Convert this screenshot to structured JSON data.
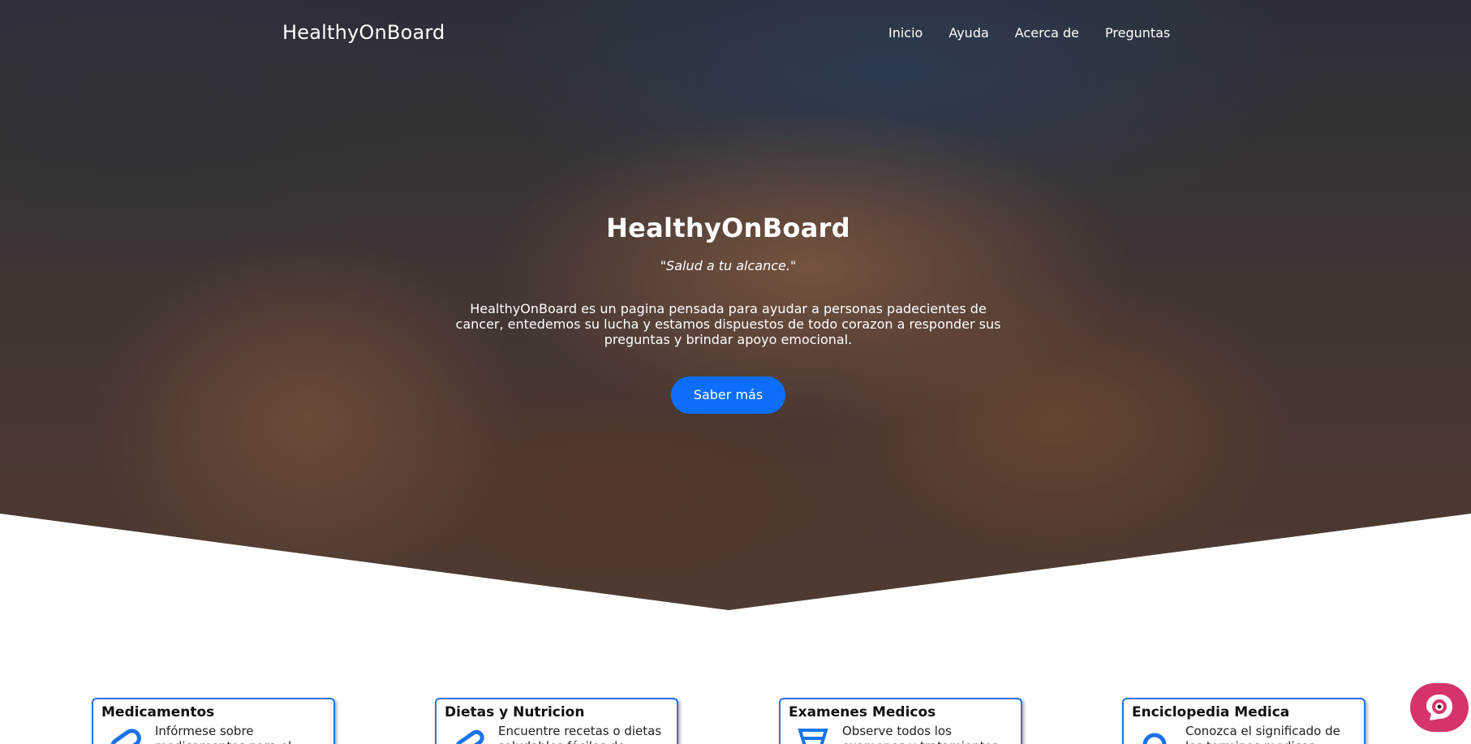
{
  "nav": {
    "brand": "HealthyOnBoard",
    "links": [
      "Inicio",
      "Ayuda",
      "Acerca de",
      "Preguntas"
    ]
  },
  "hero": {
    "title": "HealthyOnBoard",
    "quote": "\"Salud a tu alcance.\"",
    "description": "HealthyOnBoard es un pagina pensada para ayudar a personas padecientes de cancer, entedemos su lucha y estamos dispuestos de todo corazon a responder sus preguntas y brindar apoyo emocional.",
    "button": "Saber más"
  },
  "cards": [
    {
      "title": "Medicamentos",
      "text": "Infórmese sobre medicamentos para el",
      "icon": "pill-icon"
    },
    {
      "title": "Dietas y Nutricion",
      "text": "Encuentre recetas o dietas saludables fáciles de",
      "icon": "bandage-icon"
    },
    {
      "title": "Examenes Medicos",
      "text": "Observe todos los examenes y tratamientos de cancer",
      "icon": "test-tube-icon"
    },
    {
      "title": "Enciclopedia Medica",
      "text": "Conozca el significado de los terminos medicos",
      "icon": "search-icon"
    }
  ],
  "colors": {
    "accent": "#0d6efd",
    "card_border": "#1a73e8",
    "chat": "#d6336c"
  },
  "chat": {
    "icon": "chat-bot-icon"
  }
}
